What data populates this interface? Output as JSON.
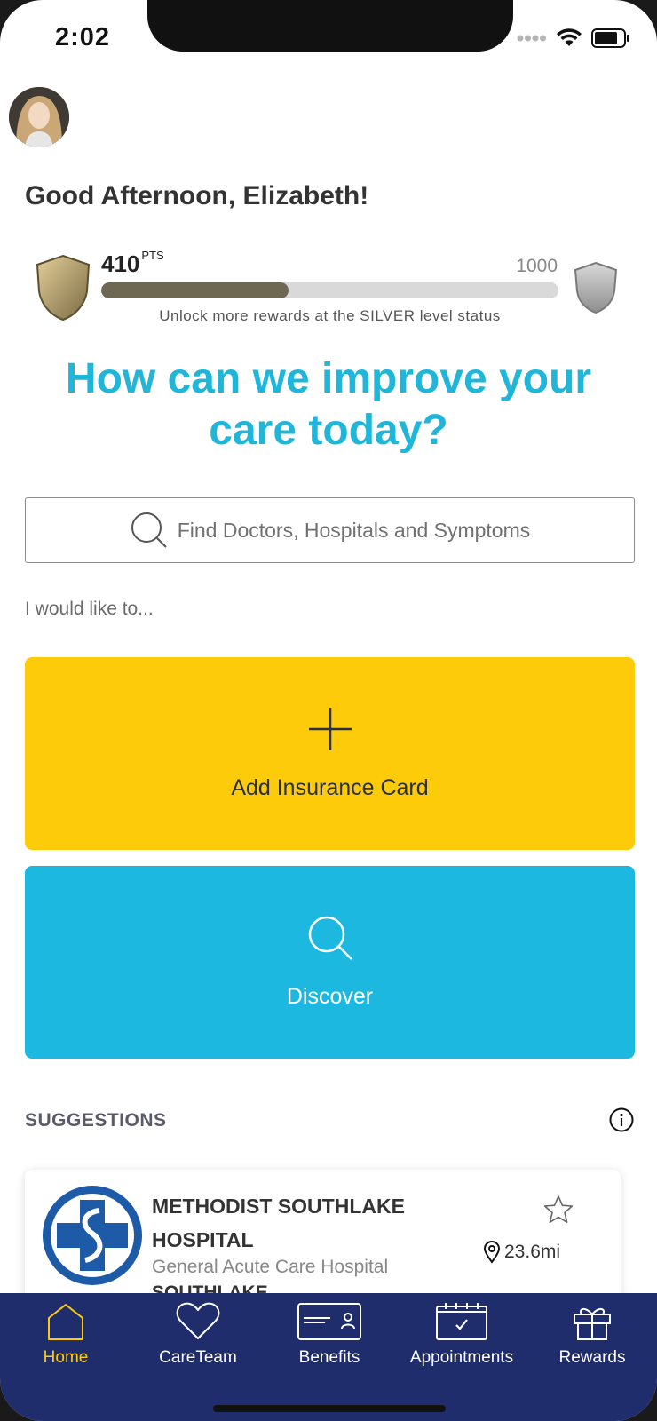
{
  "status_bar": {
    "time": "2:02"
  },
  "greeting": "Good Afternoon, Elizabeth!",
  "points": {
    "current": "410",
    "unit": "PTS",
    "max": "1000",
    "progress_fraction": 0.41,
    "unlock_text": "Unlock more rewards at the SILVER level status"
  },
  "headline": "How can we improve your care today?",
  "search": {
    "placeholder": "Find Doctors, Hospitals and Symptoms"
  },
  "intro": "I would like to...",
  "actions": [
    {
      "label": "Add Insurance Card",
      "icon": "plus-icon"
    },
    {
      "label": "Discover",
      "icon": "search-icon"
    }
  ],
  "suggestions": {
    "heading": "SUGGESTIONS",
    "items": [
      {
        "name": "METHODIST SOUTHLAKE HOSPITAL",
        "type": "General Acute Care Hospital",
        "city": "SOUTHLAKE",
        "distance": "23.6mi"
      }
    ]
  },
  "tabs": [
    {
      "label": "Home",
      "icon": "home-icon",
      "active": true
    },
    {
      "label": "CareTeam",
      "icon": "heart-icon",
      "active": false
    },
    {
      "label": "Benefits",
      "icon": "card-icon",
      "active": false
    },
    {
      "label": "Appointments",
      "icon": "calendar-icon",
      "active": false
    },
    {
      "label": "Rewards",
      "icon": "gift-icon",
      "active": false
    }
  ],
  "colors": {
    "accent_blue": "#20b6d9",
    "yellow": "#fdcb0a",
    "tabbar": "#1f2d6c",
    "progress": "#6e6751"
  }
}
